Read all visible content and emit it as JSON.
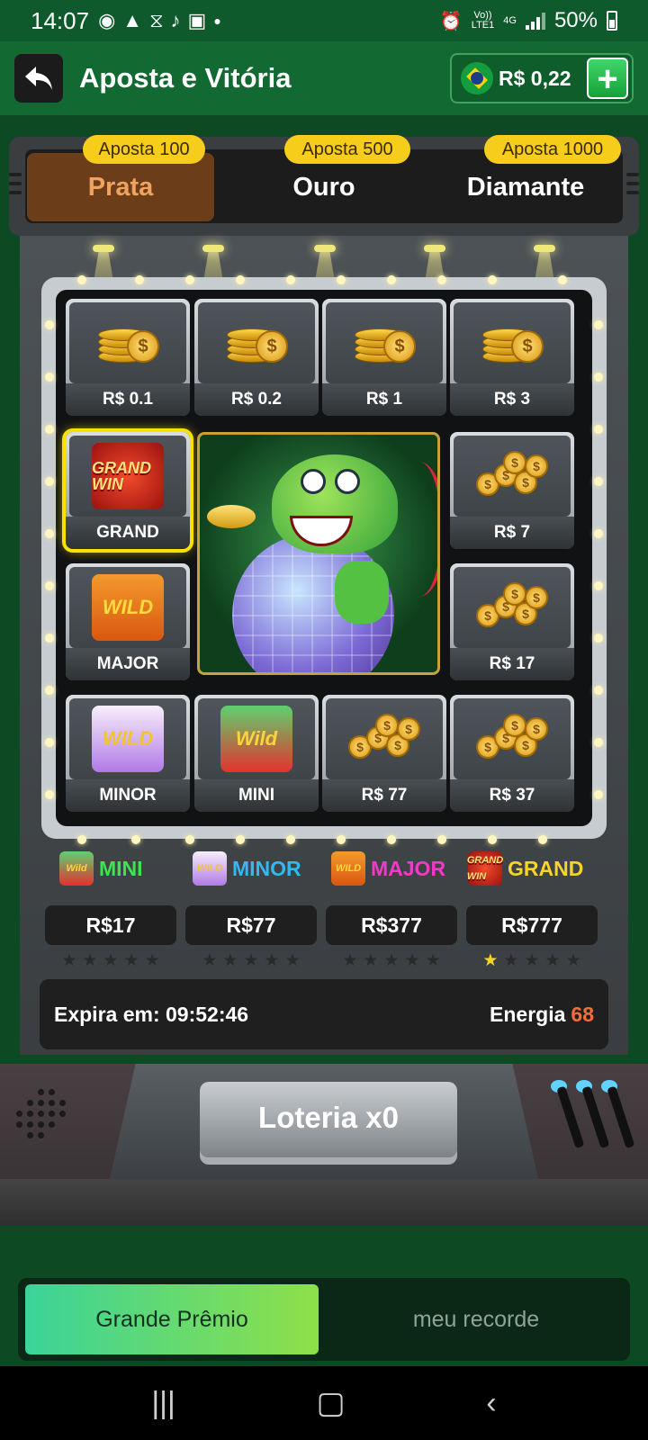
{
  "status": {
    "time": "14:07",
    "network_top": "Vo))",
    "network_bottom": "LTE1",
    "network_type": "4G",
    "battery": "50%"
  },
  "header": {
    "title": "Aposta e Vitória",
    "balance": "R$ 0,22",
    "plus": "+"
  },
  "tiers": [
    {
      "badge": "Aposta 100",
      "label": "Prata",
      "active": true
    },
    {
      "badge": "Aposta 500",
      "label": "Ouro",
      "active": false
    },
    {
      "badge": "Aposta 1000",
      "label": "Diamante",
      "active": false
    }
  ],
  "grid": {
    "row1": [
      "R$ 0.1",
      "R$ 0.2",
      "R$ 1",
      "R$ 3"
    ],
    "left": [
      "GRAND",
      "MAJOR"
    ],
    "right": [
      "R$ 7",
      "R$ 17"
    ],
    "row4": [
      "MINOR",
      "MINI",
      "R$ 77",
      "R$ 37"
    ],
    "badge_texts": {
      "grand": "GRAND WIN",
      "wild": "WILD",
      "wild_dragon": "Wild"
    }
  },
  "jackpots": [
    {
      "name": "MINI",
      "value": "R$17",
      "color": "#3fe24f",
      "stars_on": 0
    },
    {
      "name": "MINOR",
      "value": "R$77",
      "color": "#35b7f0",
      "stars_on": 0
    },
    {
      "name": "MAJOR",
      "value": "R$377",
      "color": "#f03bc7",
      "stars_on": 0
    },
    {
      "name": "GRAND",
      "value": "R$777",
      "color": "#f6d52a",
      "stars_on": 1
    }
  ],
  "timer": {
    "label": "Expira em: 09:52:46",
    "energy_label": "Energia",
    "energy_value": "68"
  },
  "lottery": {
    "label": "Loteria x0"
  },
  "tabs": [
    {
      "label": "Grande Prêmio",
      "active": true
    },
    {
      "label": "meu recorde",
      "active": false
    }
  ],
  "colors": {
    "accent_green": "#126a32",
    "tier_active": "#6b3d19",
    "badge_yellow": "#f6cd1a"
  }
}
